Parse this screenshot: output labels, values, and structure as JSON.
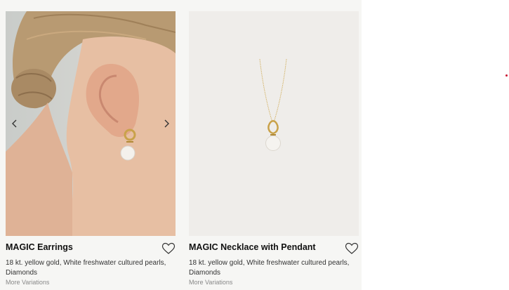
{
  "products": [
    {
      "name": "MAGIC Earrings",
      "description": "18 kt. yellow gold, White freshwater cultured pearls, Diamonds",
      "more": "More Variations",
      "prev_icon": "chevron-left-icon",
      "next_icon": "chevron-right-icon",
      "wishlist_icon": "heart-outline-icon"
    },
    {
      "name": "MAGIC Necklace with Pendant",
      "description": "18 kt. yellow gold, White freshwater cultured pearls, Diamonds",
      "more": "More Variations",
      "wishlist_icon": "heart-outline-icon"
    }
  ],
  "colors": {
    "background": "#f6f6f4",
    "accent_dot": "#c8102e",
    "gold": "#c9a24a"
  }
}
